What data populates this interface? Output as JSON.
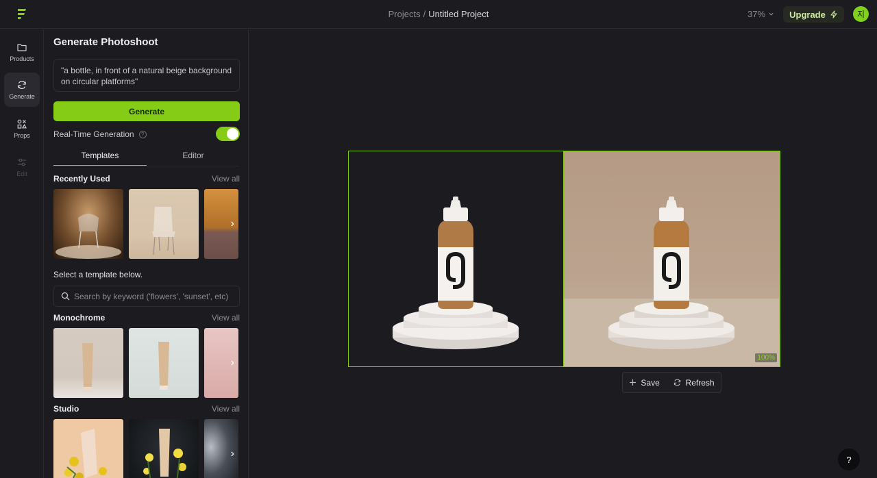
{
  "topbar": {
    "breadcrumb_parent": "Projects",
    "breadcrumb_separator": "/",
    "breadcrumb_current": "Untitled Project",
    "zoom": "37%",
    "upgrade_label": "Upgrade",
    "avatar_initial": "지"
  },
  "rail": {
    "items": [
      {
        "label": "Products",
        "icon": "folder-icon"
      },
      {
        "label": "Generate",
        "icon": "refresh-icon"
      },
      {
        "label": "Props",
        "icon": "props-icon"
      },
      {
        "label": "Edit",
        "icon": "sliders-icon"
      }
    ]
  },
  "panel": {
    "title": "Generate Photoshoot",
    "prompt": "\"a bottle, in front of a natural beige background on circular platforms\"",
    "generate_label": "Generate",
    "realtime_label": "Real-Time Generation",
    "realtime_help": "?",
    "realtime_enabled": true,
    "tabs": [
      "Templates",
      "Editor"
    ],
    "recently_used": {
      "name": "Recently Used",
      "view_all": "View all"
    },
    "select_note": "Select a template below.",
    "search_placeholder": "Search by keyword ('flowers', 'sunset', etc)",
    "monochrome": {
      "name": "Monochrome",
      "view_all": "View all"
    },
    "studio": {
      "name": "Studio",
      "view_all": "View all"
    }
  },
  "canvas": {
    "badge": "100%",
    "save_label": "Save",
    "refresh_label": "Refresh",
    "help_label": "?"
  },
  "colors": {
    "accent": "#84cc16",
    "background": "#1b1b20"
  }
}
